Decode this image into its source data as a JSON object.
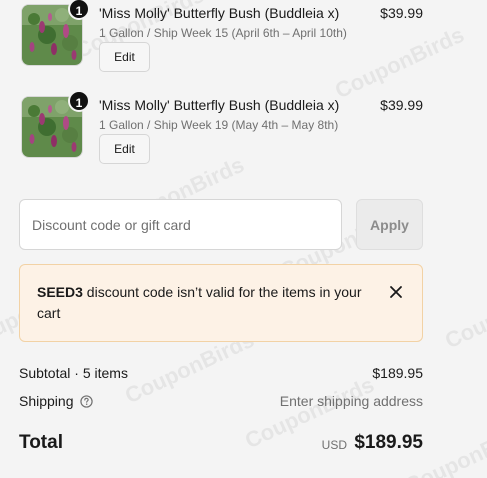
{
  "line_items": [
    {
      "quantity": "1",
      "title": "'Miss Molly' Butterfly Bush (Buddleia x)",
      "variant": "1 Gallon / Ship Week 15 (April 6th – April 10th)",
      "price": "$39.99",
      "edit_label": "Edit",
      "thumbnail_icon": "butterfly-bush-photo"
    },
    {
      "quantity": "1",
      "title": "'Miss Molly' Butterfly Bush (Buddleia x)",
      "variant": "1 Gallon / Ship Week 19 (May 4th – May 8th)",
      "price": "$39.99",
      "edit_label": "Edit",
      "thumbnail_icon": "butterfly-bush-photo"
    }
  ],
  "discount": {
    "placeholder": "Discount code or gift card",
    "value": "",
    "apply_label": "Apply"
  },
  "alert": {
    "code": "SEED3",
    "message": " discount code isn’t valid for the items in your cart",
    "close_icon": "close-icon"
  },
  "summary": {
    "subtotal_label": "Subtotal · 5 items",
    "subtotal_value": "$189.95",
    "shipping_label": "Shipping",
    "shipping_value": "Enter shipping address",
    "total_label": "Total",
    "currency": "USD",
    "total_value": "$189.95"
  },
  "watermark": "CouponBirds",
  "colors": {
    "background": "#f4f4f4",
    "alert_bg": "#fdf2e6",
    "alert_border": "#f2d2a5",
    "badge": "#111111"
  }
}
